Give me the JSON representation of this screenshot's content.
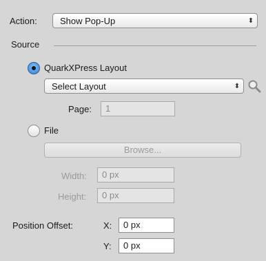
{
  "action": {
    "label": "Action:",
    "value": "Show Pop-Up"
  },
  "source": {
    "label": "Source",
    "layout_option": {
      "label": "QuarkXPress Layout",
      "selected": true
    },
    "layout_select": {
      "value": "Select Layout"
    },
    "page": {
      "label": "Page:",
      "value": "1"
    },
    "file_option": {
      "label": "File",
      "selected": false
    },
    "browse_label": "Browse...",
    "width": {
      "label": "Width:",
      "value": "0 px"
    },
    "height": {
      "label": "Height:",
      "value": "0 px"
    }
  },
  "position_offset": {
    "label": "Position Offset:",
    "x": {
      "label": "X:",
      "value": "0 px"
    },
    "y": {
      "label": "Y:",
      "value": "0 px"
    }
  },
  "icons": {
    "popup_arrows": "updown-arrows-icon",
    "search": "magnifier-icon"
  },
  "colors": {
    "panel_bg": "#d6d6d6",
    "radio_selected": "#2f7fd8"
  }
}
